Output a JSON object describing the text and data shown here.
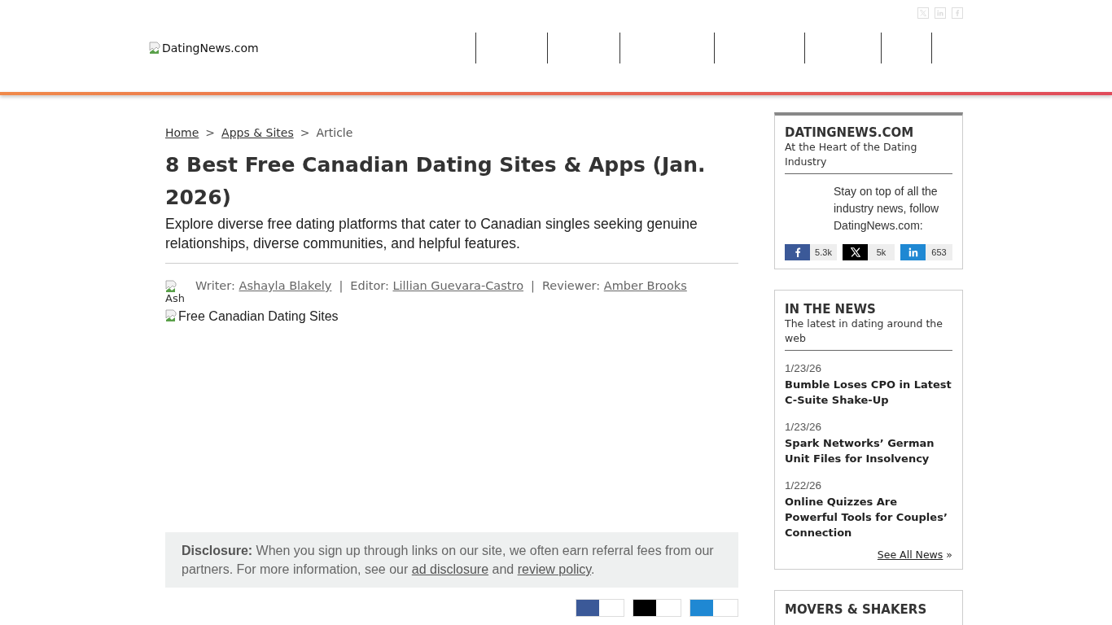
{
  "header": {
    "social_icons": [
      {
        "kind": "x"
      },
      {
        "kind": "linkedin"
      },
      {
        "kind": "facebook"
      }
    ],
    "logo_alt": "DatingNews.com"
  },
  "breadcrumb": [
    {
      "kind": "link",
      "text": "Home"
    },
    {
      "kind": "sep",
      "text": ">"
    },
    {
      "kind": "link",
      "text": "Apps & Sites"
    },
    {
      "kind": "sep",
      "text": ">"
    },
    {
      "kind": "current",
      "text": "Article"
    }
  ],
  "article": {
    "title": "8 Best Free Canadian Dating Sites & Apps (Jan. 2026)",
    "subtitle": "Explore diverse free dating platforms that cater to Canadian singles seeking genuine relationships, diverse communities, and helpful features.",
    "avatar_alt": "Ash",
    "credits": [
      {
        "role": "Writer:",
        "name": "Ashayla Blakely",
        "separator": "|"
      },
      {
        "role": "Editor:",
        "name": "Lillian Guevara-Castro",
        "separator": "|"
      },
      {
        "role": "Reviewer:",
        "name": "Amber Brooks"
      }
    ],
    "image_alt": "Free Canadian Dating Sites",
    "disclosure": [
      {
        "kind": "bold",
        "text": "Disclosure:"
      },
      {
        "kind": "text",
        "text": " When you sign up through links on our site, we often earn referral fees from our partners. For more information, see our "
      },
      {
        "kind": "link",
        "text": "ad disclosure"
      },
      {
        "kind": "text",
        "text": " and "
      },
      {
        "kind": "link",
        "text": "review policy"
      },
      {
        "kind": "text",
        "text": "."
      }
    ],
    "share_buttons": [
      {
        "kind": "facebook"
      },
      {
        "kind": "x"
      },
      {
        "kind": "linkedin"
      }
    ]
  },
  "sidebar": {
    "follow_card": {
      "title": "DATINGNEWS.COM",
      "tagline": "At the Heart of the Dating Industry",
      "text": "Stay on top of all the industry news, follow DatingNews.com:",
      "counts": [
        {
          "kind": "facebook",
          "count": "5.3k"
        },
        {
          "kind": "x",
          "count": "5k"
        },
        {
          "kind": "linkedin",
          "count": "653"
        }
      ]
    },
    "news_card": {
      "title": "IN THE NEWS",
      "tagline": "The latest in dating around the web",
      "items": [
        {
          "date": "1/23/26",
          "headline": "Bumble Loses CPO in Latest C-Suite Shake-Up"
        },
        {
          "date": "1/23/26",
          "headline": "Spark Networks’ German Unit Files for Insolvency"
        },
        {
          "date": "1/22/26",
          "headline": "Online Quizzes Are Powerful Tools for Couples’ Connection"
        }
      ],
      "see_all": "See All News",
      "see_all_mark": "»"
    },
    "movers_card": {
      "title": "MOVERS & SHAKERS"
    }
  }
}
